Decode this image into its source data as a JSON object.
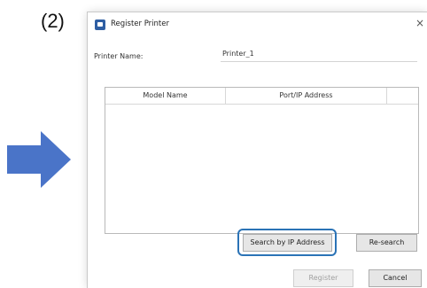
{
  "step_label": "(2)",
  "dialog": {
    "title": "Register Printer",
    "close_glyph": "×",
    "printer_name_label": "Printer Name:",
    "printer_name_value": "Printer_1",
    "columns": [
      "Model Name",
      "Port/IP Address"
    ],
    "rows": [],
    "buttons": {
      "search_ip": "Search by IP Address",
      "research": "Re-search",
      "register": "Register",
      "cancel": "Cancel"
    },
    "register_enabled": false
  },
  "annotations": {
    "highlighted_button": "search_ip",
    "arrow_direction": "right"
  },
  "colors": {
    "arrow": "#4a74c8",
    "highlight": "#2b73b6",
    "app_icon": "#2f5fa3"
  },
  "icons": {
    "arrow": "arrow-right-icon",
    "app": "printer-app-icon",
    "close": "close-icon"
  }
}
